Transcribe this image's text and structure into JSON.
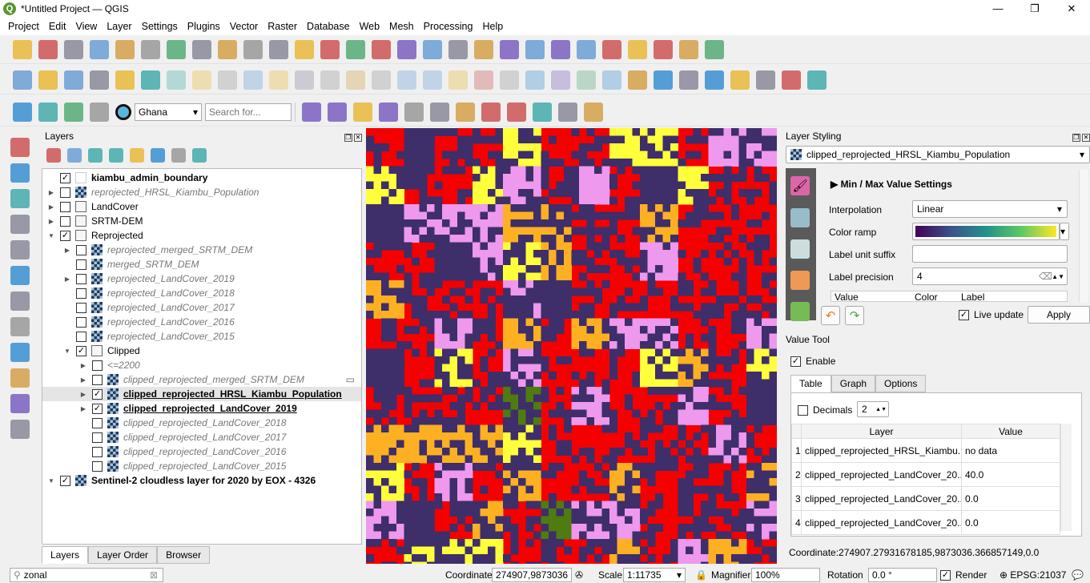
{
  "window": {
    "title": "*Untitled Project — QGIS",
    "logo": "Q",
    "controls": [
      "—",
      "❐",
      "✕"
    ]
  },
  "menu": [
    "Project",
    "Edit",
    "View",
    "Layer",
    "Settings",
    "Plugins",
    "Vector",
    "Raster",
    "Database",
    "Web",
    "Mesh",
    "Processing",
    "Help"
  ],
  "toolbar1": [
    "new-project",
    "open-project",
    "save-project",
    "save-as",
    "print-layout",
    "pan",
    "pan-to-selection",
    "zoom-in",
    "zoom-out",
    "zoom-full",
    "zoom-selection",
    "zoom-layer",
    "zoom-native",
    "zoom-last",
    "zoom-next",
    "new-bookmark",
    "show-bookmarks",
    "refresh",
    "temporal",
    "identify",
    "open-attribute-table",
    "field-calculator",
    "processing-toolbox",
    "statistics",
    "measure",
    "map-tips",
    "annotation",
    "text-annotation"
  ],
  "toolbar2": [
    "add-raster",
    "add-vector",
    "digitize",
    "edit-pencil",
    "add-wms",
    "add-spatialite",
    "current-edits",
    "toggle-editing",
    "save-edits",
    "add-feature",
    "vertex-tool",
    "copy-features",
    "delete",
    "cut",
    "copy",
    "paste",
    "undo",
    "redo",
    "label",
    "pin-label",
    "highlight-label",
    "show-hide-labels",
    "move-label",
    "rotate-label",
    "change-label",
    "db-manager",
    "topology",
    "geocoder",
    "osm",
    "about",
    "georeferencer",
    "qgis2web"
  ],
  "toolbar3": {
    "icons_before": [
      "select-features",
      "deselect",
      "select-by-expression",
      "select-location"
    ],
    "search_icon": "locator-search",
    "country": "Ghana",
    "search_placeholder": "Search for...",
    "icons_after": [
      "profile",
      "hcmgis",
      "semi-auto",
      "python-console",
      "fire",
      "installer",
      "openlayers",
      "layers",
      "globe",
      "green-icon",
      "info",
      "curve"
    ]
  },
  "left_toolbar": [
    "new-shapefile",
    "new-geopackage",
    "new-gpx",
    "new-virtual",
    "add-vector",
    "add-raster",
    "add-mesh",
    "add-postgis",
    "add-wms",
    "add-wfs",
    "add-wcs",
    "add-delimited"
  ],
  "layers_panel": {
    "title": "Layers",
    "tools": [
      "style-manager",
      "add-group",
      "manage-visibility",
      "filter",
      "expression-filter",
      "expand-all",
      "collapse-all",
      "remove-layer"
    ],
    "items": [
      {
        "name": "kiambu_admin_boundary",
        "checked": true,
        "level": 0,
        "expander": "",
        "icon": "vector",
        "style": "bold"
      },
      {
        "name": "reprojected_HRSL_Kiambu_Population",
        "checked": false,
        "level": 0,
        "expander": "▶",
        "icon": "raster",
        "style": "italic"
      },
      {
        "name": "LandCover",
        "checked": false,
        "level": 0,
        "expander": "▶",
        "icon": "group",
        "style": ""
      },
      {
        "name": "SRTM-DEM",
        "checked": false,
        "level": 0,
        "expander": "▶",
        "icon": "group",
        "style": ""
      },
      {
        "name": "Reprojected",
        "checked": true,
        "level": 0,
        "expander": "▼",
        "icon": "group",
        "style": ""
      },
      {
        "name": "reprojected_merged_SRTM_DEM",
        "checked": false,
        "level": 1,
        "expander": "▶",
        "icon": "raster",
        "style": "italic"
      },
      {
        "name": "merged_SRTM_DEM",
        "checked": false,
        "level": 1,
        "expander": "",
        "icon": "raster",
        "style": "italic"
      },
      {
        "name": "reprojected_LandCover_2019",
        "checked": false,
        "level": 1,
        "expander": "▶",
        "icon": "raster",
        "style": "italic"
      },
      {
        "name": "reprojected_LandCover_2018",
        "checked": false,
        "level": 1,
        "expander": "",
        "icon": "raster",
        "style": "italic"
      },
      {
        "name": "reprojected_LandCover_2017",
        "checked": false,
        "level": 1,
        "expander": "",
        "icon": "raster",
        "style": "italic"
      },
      {
        "name": "reprojected_LandCover_2016",
        "checked": false,
        "level": 1,
        "expander": "",
        "icon": "raster",
        "style": "italic"
      },
      {
        "name": "reprojected_LandCover_2015",
        "checked": false,
        "level": 1,
        "expander": "",
        "icon": "raster",
        "style": "italic"
      },
      {
        "name": "Clipped",
        "checked": true,
        "level": 1,
        "expander": "▼",
        "icon": "group",
        "style": ""
      },
      {
        "name": "<=2200",
        "checked": false,
        "level": 2,
        "expander": "▶",
        "icon": "",
        "style": "italic"
      },
      {
        "name": "clipped_reprojected_merged_SRTM_DEM",
        "checked": false,
        "level": 2,
        "expander": "▶",
        "icon": "raster",
        "style": "italic",
        "indicator": true
      },
      {
        "name": "clipped_reprojected_HRSL_Kiambu_Population",
        "checked": true,
        "level": 2,
        "expander": "▶",
        "icon": "raster",
        "style": "bold under",
        "selected": true
      },
      {
        "name": "clipped_reprojected_LandCover_2019",
        "checked": true,
        "level": 2,
        "expander": "▶",
        "icon": "raster",
        "style": "bold under"
      },
      {
        "name": "clipped_reprojected_LandCover_2018",
        "checked": false,
        "level": 2,
        "expander": "",
        "icon": "raster",
        "style": "italic"
      },
      {
        "name": "clipped_reprojected_LandCover_2017",
        "checked": false,
        "level": 2,
        "expander": "",
        "icon": "raster",
        "style": "italic"
      },
      {
        "name": "clipped_reprojected_LandCover_2016",
        "checked": false,
        "level": 2,
        "expander": "",
        "icon": "raster",
        "style": "italic"
      },
      {
        "name": "clipped_reprojected_LandCover_2015",
        "checked": false,
        "level": 2,
        "expander": "",
        "icon": "raster",
        "style": "italic"
      },
      {
        "name": "Sentinel-2 cloudless layer for 2020 by EOX - 4326",
        "checked": true,
        "level": 0,
        "expander": "▼",
        "icon": "raster",
        "style": "bold"
      }
    ],
    "tabs": [
      "Layers",
      "Layer Order",
      "Browser"
    ],
    "active_tab": "Layers"
  },
  "map": {
    "palette": [
      "#f40000",
      "#3e2e6a",
      "#ee98ee",
      "#ffff3c",
      "#fdb022",
      "#4f7b10"
    ]
  },
  "layer_styling": {
    "title": "Layer Styling",
    "layer": "clipped_reprojected_HRSL_Kiambu_Population",
    "section": "Min / Max Value Settings",
    "interpolation_label": "Interpolation",
    "interpolation": "Linear",
    "color_ramp_label": "Color ramp",
    "color_ramp": [
      "#440154",
      "#3b528b",
      "#21918c",
      "#5ec962",
      "#fde725"
    ],
    "suffix_label": "Label unit suffix",
    "suffix": "",
    "precision_label": "Label precision",
    "precision": "4",
    "columns": [
      "Value",
      "Color",
      "Label"
    ],
    "live_update": "Live update",
    "live_checked": true,
    "apply": "Apply"
  },
  "value_tool": {
    "title": "Value Tool",
    "enable": "Enable",
    "enabled": true,
    "tabs": [
      "Table",
      "Graph",
      "Options"
    ],
    "decimals_label": "Decimals",
    "decimals": "2",
    "columns": [
      "Layer",
      "Value"
    ],
    "rows": [
      [
        "1",
        "clipped_reprojected_HRSL_Kiambu...",
        "no data"
      ],
      [
        "2",
        "clipped_reprojected_LandCover_20...",
        "40.0"
      ],
      [
        "3",
        "clipped_reprojected_LandCover_20...",
        "0.0"
      ],
      [
        "4",
        "clipped_reprojected_LandCover_20...",
        "0.0"
      ]
    ],
    "coordinate": "Coordinate:274907.27931678185,9873036.366857149,0.0"
  },
  "status": {
    "search": "zonal",
    "coordinate_label": "Coordinate",
    "coordinate": "274907,9873036",
    "scale_label": "Scale",
    "scale": "1:11735",
    "magnifier_label": "Magnifier",
    "magnifier": "100%",
    "rotation_label": "Rotation",
    "rotation": "0.0 °",
    "render": "Render",
    "crs": "EPSG:21037"
  }
}
